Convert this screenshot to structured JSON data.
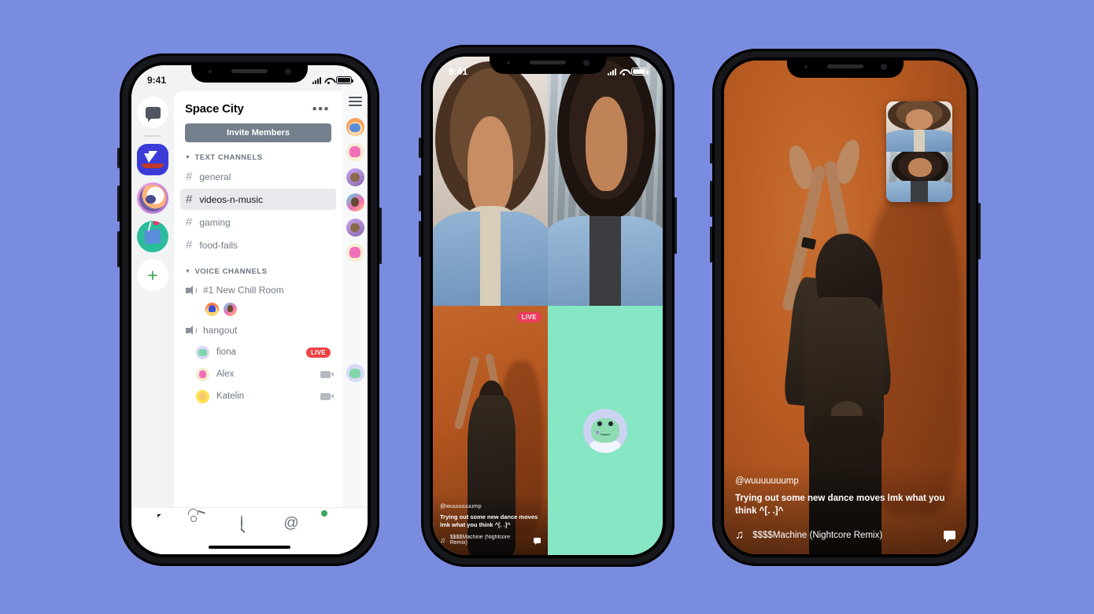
{
  "background_color": "#7a8ce0",
  "phone1": {
    "status_bar": {
      "time": "9:41",
      "signal_icon": "cellular-bars-icon",
      "wifi_icon": "wifi-icon",
      "battery_icon": "battery-icon"
    },
    "server_rail": [
      {
        "name": "direct-messages",
        "icon": "chat-bubble-icon"
      },
      {
        "name": "space-city-server",
        "icon": "sailboat-icon",
        "selected": true
      },
      {
        "name": "astronaut-server",
        "icon": "astronaut-avatar-icon"
      },
      {
        "name": "art-server",
        "icon": "paint-palette-icon"
      },
      {
        "name": "add-server",
        "icon": "plus-icon",
        "label": "+"
      }
    ],
    "header": {
      "title": "Space City",
      "overflow_label": "•••"
    },
    "invite_button": {
      "label": "Invite Members",
      "color": "#747f8d"
    },
    "text_channels": {
      "category": "TEXT CHANNELS",
      "items": [
        {
          "name": "general",
          "active": false
        },
        {
          "name": "videos-n-music",
          "active": true
        },
        {
          "name": "gaming",
          "active": false
        },
        {
          "name": "food-fails",
          "active": false
        }
      ]
    },
    "voice_channels": {
      "category": "VOICE CHANNELS",
      "items": [
        {
          "name": "#1 New Chill Room",
          "participant_count": 2
        },
        {
          "name": "hangout"
        }
      ],
      "hangout_members": [
        {
          "name": "fiona",
          "badge": "LIVE",
          "badge_color": "#ed4245",
          "avatar": "frog-avatar"
        },
        {
          "name": "Alex",
          "icon": "video-camera-icon",
          "avatar": "bunny-avatar"
        },
        {
          "name": "Katelin",
          "icon": "video-camera-icon",
          "avatar": "yellow-avatar"
        }
      ]
    },
    "member_list": {
      "menu_icon": "hamburger-menu-icon"
    },
    "tab_bar": [
      {
        "name": "servers-tab",
        "icon": "discord-logo-icon",
        "active": true
      },
      {
        "name": "friends-tab",
        "icon": "friends-icon"
      },
      {
        "name": "search-tab",
        "icon": "search-icon"
      },
      {
        "name": "mentions-tab",
        "icon": "at-mention-icon",
        "label": "@"
      },
      {
        "name": "profile-tab",
        "icon": "user-avatar-icon",
        "status": "online"
      }
    ]
  },
  "phone2": {
    "status_bar": {
      "time": "9:41"
    },
    "tiles": [
      {
        "name": "participant-video-top-left",
        "kind": "video"
      },
      {
        "name": "participant-video-top-right",
        "kind": "video"
      },
      {
        "name": "live-stream-tile",
        "kind": "stream",
        "badge": "LIVE",
        "badge_color": "#ef3a5d"
      },
      {
        "name": "waiting-participant-tile",
        "kind": "avatar",
        "background": "#87e6c4",
        "avatar": "frog-avatar"
      }
    ],
    "stream_overlay": {
      "handle": "@wuuuuuuump",
      "caption": "Trying out some new dance moves lmk what you think ^[. .]^",
      "music_icon": "music-note-icon",
      "track": "$$$$Machine (Nightcore Remix)",
      "comment_icon": "comment-bubble-icon"
    }
  },
  "phone3": {
    "stream_overlay": {
      "handle": "@wuuuuuuump",
      "caption": "Trying out some new dance moves lmk what you think ^[. .]^",
      "music_icon": "music-note-icon",
      "track": "$$$$Machine (Nightcore Remix)",
      "comment_icon": "comment-bubble-icon"
    },
    "picture_in_picture": {
      "name": "pip-video-stack",
      "tiles": [
        {
          "name": "pip-video-top"
        },
        {
          "name": "pip-video-bottom"
        }
      ]
    }
  }
}
